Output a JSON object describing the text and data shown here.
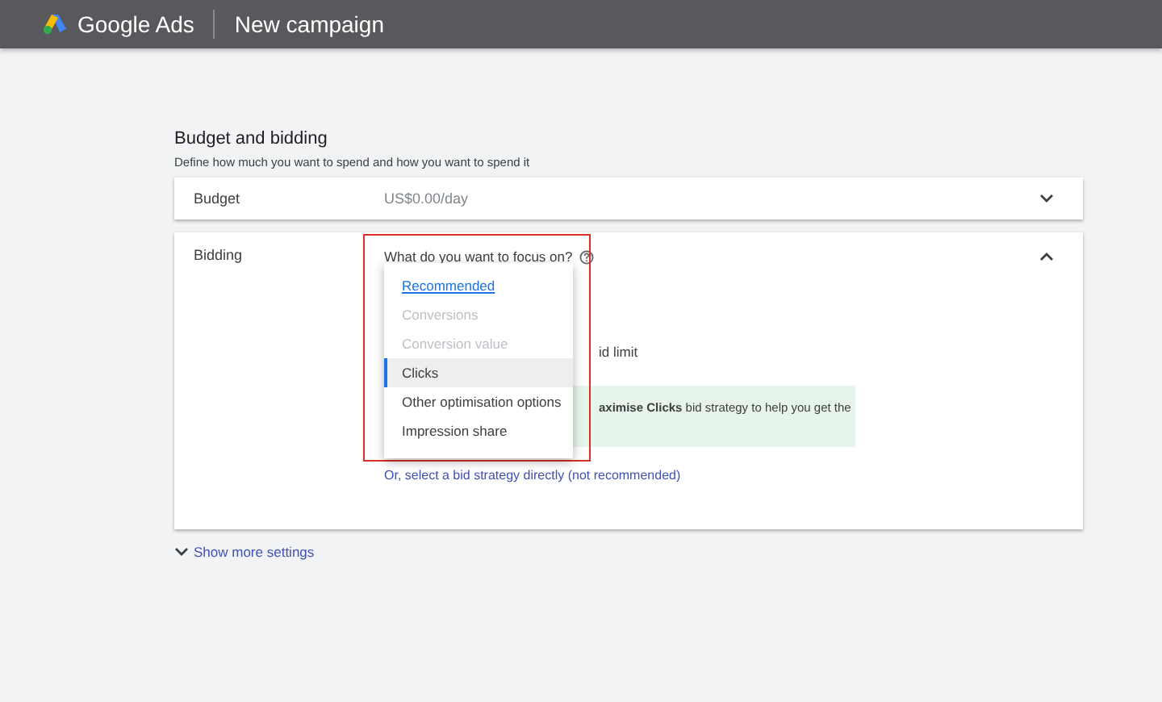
{
  "header": {
    "product": "Google Ads",
    "page_title": "New campaign"
  },
  "section": {
    "title": "Budget and bidding",
    "description": "Define how much you want to spend and how you want to spend it"
  },
  "budget": {
    "label": "Budget",
    "value": "US$0.00/day",
    "expanded": false
  },
  "bidding": {
    "label": "Bidding",
    "expanded": true,
    "question": "What do you want to focus on?",
    "hidden_fragment": "id limit",
    "tip": "**aximise Clicks** bid strategy to help you get the",
    "link": "Or, select a bid strategy directly (not recommended)",
    "menu": [
      {
        "label": "Recommended",
        "kind": "heading",
        "disabled": false,
        "selected": false
      },
      {
        "label": "Conversions",
        "kind": "option",
        "disabled": true,
        "selected": false
      },
      {
        "label": "Conversion value",
        "kind": "option",
        "disabled": true,
        "selected": false
      },
      {
        "label": "Clicks",
        "kind": "option",
        "disabled": false,
        "selected": true
      },
      {
        "label": "Other optimisation options",
        "kind": "option",
        "disabled": false,
        "selected": false
      },
      {
        "label": "Impression share",
        "kind": "option",
        "disabled": false,
        "selected": false
      }
    ]
  },
  "more_settings": {
    "label": "Show more settings",
    "expanded": false
  }
}
